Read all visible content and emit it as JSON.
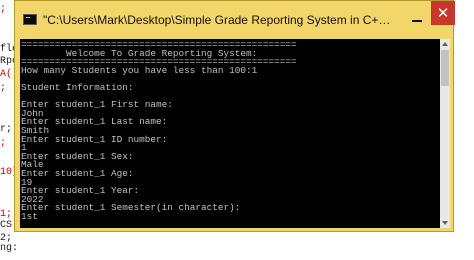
{
  "editor_fragments": [
    {
      "text": ";",
      "color": "#cc0000"
    },
    {
      "text": "fle",
      "color": "#1a1a1a"
    },
    {
      "text": "Rpc",
      "color": "#1a1a1a"
    },
    {
      "text": "A()",
      "color": "#cc0000"
    },
    {
      "text": ";",
      "color": "#cc0000"
    },
    {
      "text": "r;",
      "color": "#1a1a1a"
    },
    {
      "text": ";",
      "color": "#cc0000"
    },
    {
      "text": "10]",
      "color": "#cc0000"
    },
    {
      "text": "1;",
      "color": "#cc0000"
    },
    {
      "text": "CS;",
      "color": "#1a1a1a"
    },
    {
      "text": "2;",
      "color": "#1a1a1a"
    },
    {
      "text": "ng:",
      "color": "#1a1a1a"
    }
  ],
  "window": {
    "title": "\"C:\\Users\\Mark\\Desktop\\Simple Grade Reporting System in C++\\Student Grade...",
    "close_glyph": "✕",
    "titlebar_color": "#f3d66a"
  },
  "console": {
    "text_color": "#c0c0c0",
    "background": "#000000",
    "lines": [
      "=================================================",
      "        Welcome To Grade Reporting System:",
      "=================================================",
      "How many Students you have less than 100:1",
      "",
      "Student Information:",
      "",
      "Enter student_1 First name:",
      "John",
      "Enter student_1 Last name:",
      "Smith",
      "Enter student_1 ID number:",
      "1",
      "Enter student_1 Sex:",
      "Male",
      "Enter student_1 Age:",
      "19",
      "Enter student_1 Year:",
      "2022",
      "Enter student_1 Semester(in character):",
      "1st"
    ]
  }
}
